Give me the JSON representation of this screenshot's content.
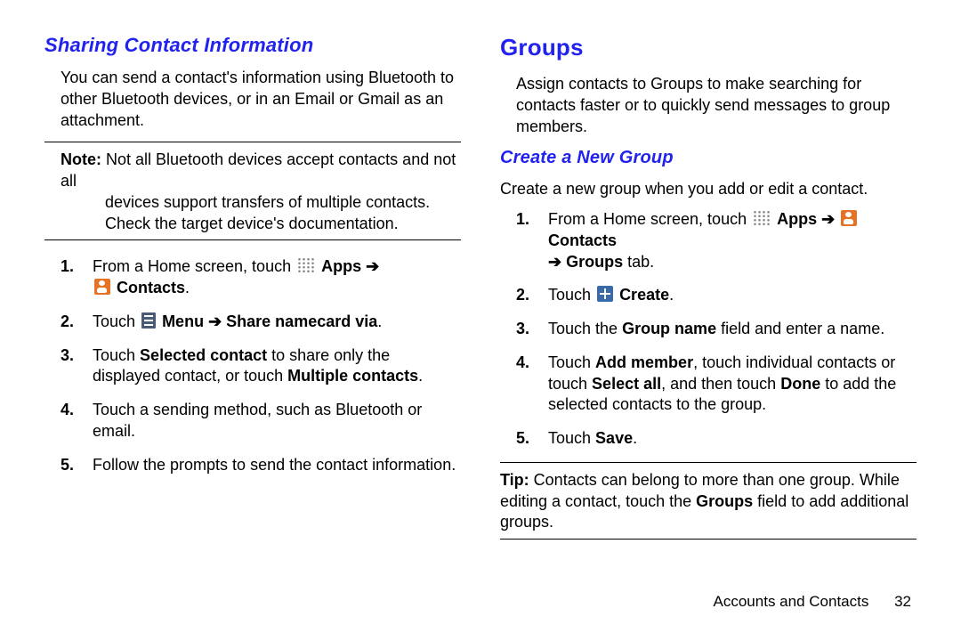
{
  "left": {
    "heading": "Sharing Contact Information",
    "intro": "You can send a contact's information using Bluetooth to other Bluetooth devices, or in an Email or Gmail as an attachment.",
    "note_label": "Note:",
    "note_text_line1": " Not all Bluetooth devices accept contacts and not all",
    "note_text_line2": "devices support transfers of multiple contacts. Check the target device's documentation.",
    "steps": {
      "s1_a": "From a Home screen, touch ",
      "s1_apps": "Apps",
      "s1_arrow1": " ➔",
      "s1_contacts": "Contacts",
      "s1_period": ".",
      "s2_a": "Touch ",
      "s2_menu": "Menu",
      "s2_arrow": " ➔ ",
      "s2_share": "Share namecard via",
      "s2_period": ".",
      "s3_a": "Touch ",
      "s3_sel": "Selected contact",
      "s3_b": " to share only the displayed contact, or touch ",
      "s3_mult": "Multiple contacts",
      "s3_period": ".",
      "s4": "Touch a sending method, such as Bluetooth or email.",
      "s5": "Follow the prompts to send the contact information."
    }
  },
  "right": {
    "heading1": "Groups",
    "intro": "Assign contacts to Groups to make searching for contacts faster or to quickly send messages to group members.",
    "heading2": "Create a New Group",
    "subintro": "Create a new group when you add or edit a contact.",
    "steps": {
      "s1_a": "From a Home screen, touch ",
      "s1_apps": "Apps",
      "s1_arrow1": " ➔ ",
      "s1_contacts": "Contacts",
      "s1_arrow2": "➔ ",
      "s1_groups": "Groups",
      "s1_tab": " tab.",
      "s2_a": "Touch ",
      "s2_create": "Create",
      "s2_period": ".",
      "s3_a": "Touch the ",
      "s3_gn": "Group name",
      "s3_b": " field and enter a name.",
      "s4_a": "Touch ",
      "s4_add": "Add member",
      "s4_b": ", touch individual contacts or touch ",
      "s4_sel": "Select all",
      "s4_c": ", and then touch ",
      "s4_done": "Done",
      "s4_d": " to add the selected contacts to the group.",
      "s5_a": "Touch ",
      "s5_save": "Save",
      "s5_period": "."
    },
    "tip_label": "Tip:",
    "tip_a": " Contacts can belong to more than one group. While editing a contact, touch the ",
    "tip_groups": "Groups",
    "tip_b": " field to add additional groups."
  },
  "footer": {
    "section": "Accounts and Contacts",
    "page": "32"
  }
}
